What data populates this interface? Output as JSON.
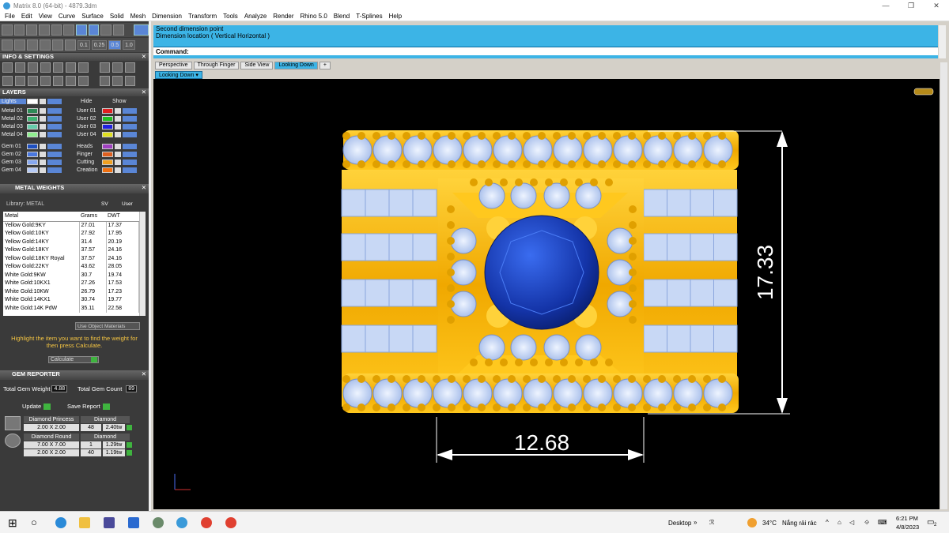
{
  "window": {
    "title": "Matrix 8.0 (64-bit) - 4879.3dm",
    "minimize": "—",
    "maximize": "❐",
    "close": "✕"
  },
  "menu": [
    "File",
    "Edit",
    "View",
    "Curve",
    "Surface",
    "Solid",
    "Mesh",
    "Dimension",
    "Transform",
    "Tools",
    "Analyze",
    "Render",
    "Rhino 5.0",
    "Blend",
    "T-Splines",
    "Help"
  ],
  "toolbar": {
    "snap_values": [
      "0.1",
      "0.25",
      "0.5",
      "1.0"
    ]
  },
  "info_settings": {
    "title": "INFO & SETTINGS"
  },
  "layers": {
    "title": "LAYERS",
    "lights": "Lights",
    "hide": "Hide",
    "show": "Show",
    "left": [
      {
        "name": "Metal 01",
        "color": "#2e8b57"
      },
      {
        "name": "Metal 02",
        "color": "#3cb371"
      },
      {
        "name": "Metal 03",
        "color": "#66cdaa"
      },
      {
        "name": "Metal 04",
        "color": "#90ee90"
      },
      {
        "name": "Gem 01",
        "color": "#1e4fbf"
      },
      {
        "name": "Gem 02",
        "color": "#4a78e0"
      },
      {
        "name": "Gem 03",
        "color": "#87a8f0"
      },
      {
        "name": "Gem 04",
        "color": "#b5c9f5"
      }
    ],
    "right": [
      {
        "name": "User 01",
        "color": "#e02020"
      },
      {
        "name": "User 02",
        "color": "#20c020"
      },
      {
        "name": "User 03",
        "color": "#2020e0"
      },
      {
        "name": "User 04",
        "color": "#e0e020"
      },
      {
        "name": "Heads",
        "color": "#a040c0"
      },
      {
        "name": "Finger",
        "color": "#e06020"
      },
      {
        "name": "Cutting",
        "color": "#f0a020"
      },
      {
        "name": "Creation",
        "color": "#f07010"
      }
    ]
  },
  "metal_weights": {
    "title": "METAL WEIGHTS",
    "library": "Library: METAL",
    "sv": "SV",
    "user": "User",
    "columns": [
      "Metal",
      "Grams",
      "DWT"
    ],
    "rows": [
      [
        "Yellow Gold:9KY",
        "27.01",
        "17.37"
      ],
      [
        "Yellow Gold:10KY",
        "27.92",
        "17.95"
      ],
      [
        "Yellow Gold:14KY",
        "31.4",
        "20.19"
      ],
      [
        "Yellow Gold:18KY",
        "37.57",
        "24.16"
      ],
      [
        "Yellow Gold:18KY Royal",
        "37.57",
        "24.16"
      ],
      [
        "Yellow Gold:22KY",
        "43.62",
        "28.05"
      ],
      [
        "White Gold:9KW",
        "30.7",
        "19.74"
      ],
      [
        "White Gold:10KX1",
        "27.26",
        "17.53"
      ],
      [
        "White Gold:10KW",
        "26.79",
        "17.23"
      ],
      [
        "White Gold:14KX1",
        "30.74",
        "19.77"
      ],
      [
        "White Gold:14K PdW",
        "35.11",
        "22.58"
      ]
    ],
    "use_object_materials": "Use Object Materials",
    "hint": "Highlight the item you want to find the weight for then press Calculate.",
    "calculate": "Calculate"
  },
  "gem_reporter": {
    "title": "GEM REPORTER",
    "total_weight_label": "Total Gem Weight",
    "total_weight": "4.88",
    "total_count_label": "Total Gem Count",
    "total_count": "89",
    "update": "Update",
    "save_report": "Save Report",
    "groups": [
      {
        "shape": "Diamond Princess",
        "type": "Diamond",
        "rows": [
          [
            "2.00 X 2.00",
            "48",
            "2.40tw"
          ]
        ]
      },
      {
        "shape": "Diamond Round",
        "type": "Diamond",
        "rows": [
          [
            "7.00 X 7.00",
            "1",
            "1.29tw"
          ],
          [
            "2.00 X 2.00",
            "40",
            "1.19tw"
          ]
        ]
      }
    ]
  },
  "command": {
    "lines": [
      "Second dimension point",
      "Dimension location ( Vertical  Horizontal )"
    ],
    "prompt": "Command:"
  },
  "viewports": {
    "tabs": [
      "Perspective",
      "Through Finger",
      "Side View",
      "Looking Down"
    ],
    "active": "Looking Down",
    "current_label": "Looking Down"
  },
  "dimensions": {
    "vertical": "17.33",
    "horizontal": "12.68"
  },
  "taskbar": {
    "desktop": "Desktop",
    "temp": "34°C",
    "weather": "Nắng rải rác",
    "time": "6:21 PM",
    "date": "4/8/2023",
    "notif": "2"
  }
}
